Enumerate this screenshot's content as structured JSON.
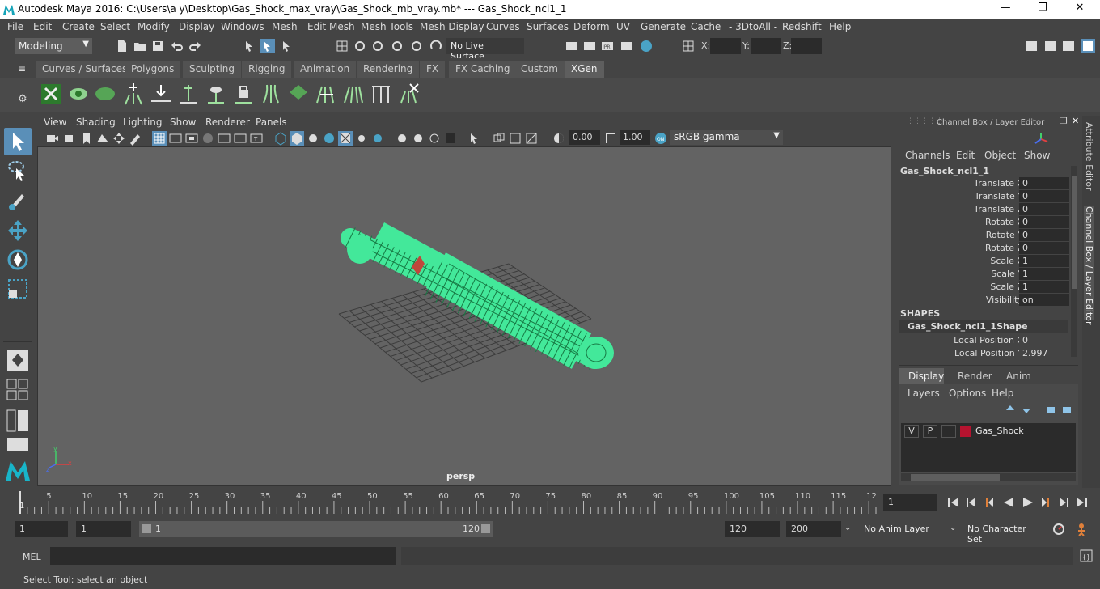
{
  "window": {
    "title": "Autodesk Maya 2016: C:\\Users\\a y\\Desktop\\Gas_Shock_max_vray\\Gas_Shock_mb_vray.mb*   ---   Gas_Shock_ncl1_1",
    "minimize": "—",
    "restore": "❐",
    "close": "✕"
  },
  "menubar": [
    "File",
    "Edit",
    "Create",
    "Select",
    "Modify",
    "Display",
    "Windows",
    "Mesh",
    "Edit Mesh",
    "Mesh Tools",
    "Mesh Display",
    "Curves",
    "Surfaces",
    "Deform",
    "UV",
    "Generate",
    "Cache",
    "- 3DtoAll -",
    "Redshift",
    "Help"
  ],
  "statusline": {
    "mode": "Modeling",
    "live_surface": "No Live Surface",
    "x_label": "X:",
    "y_label": "Y:",
    "z_label": "Z:"
  },
  "shelf_tabs": [
    "Curves / Surfaces",
    "Polygons",
    "Sculpting",
    "Rigging",
    "Animation",
    "Rendering",
    "FX",
    "FX Caching",
    "Custom",
    "XGen"
  ],
  "shelf_active": "XGen",
  "viewport": {
    "menus": [
      "View",
      "Shading",
      "Lighting",
      "Show",
      "Renderer",
      "Panels"
    ],
    "exposure": "0.00",
    "gamma": "1.00",
    "colorspace": "sRGB gamma",
    "camera_label": "persp",
    "axis_x": "x",
    "axis_y": "y",
    "axis_z": "z"
  },
  "channel_box": {
    "header": "Channel Box / Layer Editor",
    "menus": [
      "Channels",
      "Edit",
      "Object",
      "Show"
    ],
    "object_name": "Gas_Shock_ncl1_1",
    "attributes": [
      {
        "label": "Translate X",
        "value": "0"
      },
      {
        "label": "Translate Y",
        "value": "0"
      },
      {
        "label": "Translate Z",
        "value": "0"
      },
      {
        "label": "Rotate X",
        "value": "0"
      },
      {
        "label": "Rotate Y",
        "value": "0"
      },
      {
        "label": "Rotate Z",
        "value": "0"
      },
      {
        "label": "Scale X",
        "value": "1"
      },
      {
        "label": "Scale Y",
        "value": "1"
      },
      {
        "label": "Scale Z",
        "value": "1"
      },
      {
        "label": "Visibility",
        "value": "on"
      }
    ],
    "shapes_header": "SHAPES",
    "shape_name": "Gas_Shock_ncl1_1Shape",
    "shape_attributes": [
      {
        "label": "Local Position X",
        "value": "0"
      },
      {
        "label": "Local Position Y",
        "value": "2.997"
      }
    ]
  },
  "layer_editor": {
    "tabs": [
      "Display",
      "Render",
      "Anim"
    ],
    "menus": [
      "Layers",
      "Options",
      "Help"
    ],
    "layer": {
      "v": "V",
      "p": "P",
      "name": "Gas_Shock",
      "color": "#b5132f"
    }
  },
  "side_tabs": [
    "Attribute Editor",
    "Channel Box / Layer Editor"
  ],
  "timeline": {
    "ticks": [
      "1",
      "5",
      "10",
      "15",
      "20",
      "25",
      "30",
      "35",
      "40",
      "45",
      "50",
      "55",
      "60",
      "65",
      "70",
      "75",
      "80",
      "85",
      "90",
      "95",
      "100",
      "105",
      "110",
      "115",
      "12"
    ],
    "current_frame": "1"
  },
  "range": {
    "start": "1",
    "playback_start": "1",
    "slider_start": "1",
    "slider_end": "120",
    "playback_end": "120",
    "end": "200",
    "anim_layer": "No Anim Layer",
    "character_set": "No Character Set"
  },
  "cmdline": {
    "label": "MEL"
  },
  "helpline": {
    "text": "Select Tool: select an object"
  },
  "colors": {
    "wire": "#43e89a",
    "accent": "#5a8fb8",
    "layer_red": "#b5132f"
  }
}
